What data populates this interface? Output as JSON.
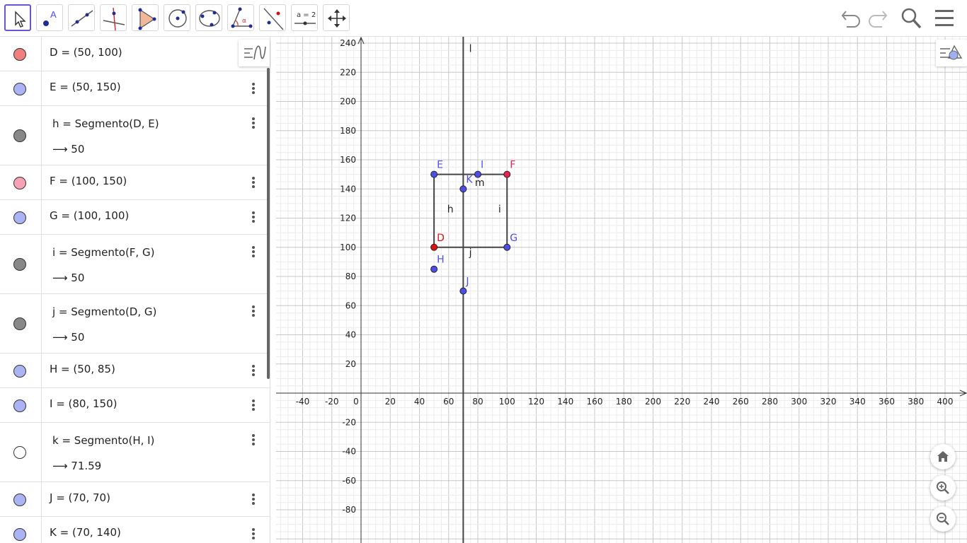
{
  "algebra": {
    "rows": [
      {
        "marble": "#f08080",
        "filled": true,
        "def": "D = (50, 100)",
        "value": ""
      },
      {
        "marble": "#aab4f5",
        "filled": true,
        "def": "E = (50, 150)",
        "value": ""
      },
      {
        "marble": "#888888",
        "filled": true,
        "def": "h = Segmento(D, E)",
        "value": "⟶ 50"
      },
      {
        "marble": "#f8a0b4",
        "filled": true,
        "def": "F = (100, 150)",
        "value": ""
      },
      {
        "marble": "#aab4f5",
        "filled": true,
        "def": "G = (100, 100)",
        "value": ""
      },
      {
        "marble": "#888888",
        "filled": true,
        "def": "i = Segmento(F, G)",
        "value": "⟶ 50"
      },
      {
        "marble": "#888888",
        "filled": true,
        "def": "j = Segmento(D, G)",
        "value": "⟶ 50"
      },
      {
        "marble": "#aab4f5",
        "filled": true,
        "def": "H = (50, 85)",
        "value": ""
      },
      {
        "marble": "#aab4f5",
        "filled": true,
        "def": "I = (80, 150)",
        "value": ""
      },
      {
        "marble": "#ffffff",
        "filled": false,
        "def": "k = Segmento(H, I)",
        "value": "⟶ 71.59"
      },
      {
        "marble": "#aab4f5",
        "filled": true,
        "def": "J = (70, 70)",
        "value": ""
      },
      {
        "marble": "#aab4f5",
        "filled": true,
        "def": "K = (70, 140)",
        "value": ""
      }
    ]
  },
  "toolbar": {
    "tools": [
      "move-tool",
      "point-tool",
      "line-tool",
      "perpendicular-line-tool",
      "polygon-tool",
      "circle-center-point-tool",
      "circle-three-points-tool",
      "angle-tool",
      "reflect-tool",
      "slider-tool",
      "move-graphics-view-tool"
    ],
    "slider_label": "a = 2"
  },
  "graphics": {
    "x_ticks": [
      "-40",
      "-20",
      "0",
      "20",
      "40",
      "60",
      "80",
      "100",
      "120",
      "140",
      "160",
      "180",
      "200",
      "220",
      "240",
      "260",
      "280",
      "300",
      "320",
      "340",
      "360",
      "380",
      "400"
    ],
    "y_ticks": [
      "240",
      "220",
      "200",
      "180",
      "160",
      "140",
      "120",
      "100",
      "80",
      "60",
      "40",
      "20",
      "-20",
      "-40",
      "-60",
      "-80"
    ],
    "points": [
      {
        "name": "D",
        "x": 50,
        "y": 100,
        "color": "#e01010"
      },
      {
        "name": "E",
        "x": 50,
        "y": 150,
        "color": "#4d4ee8"
      },
      {
        "name": "F",
        "x": 100,
        "y": 150,
        "color": "#e8234f"
      },
      {
        "name": "G",
        "x": 100,
        "y": 100,
        "color": "#4d4ee8"
      },
      {
        "name": "H",
        "x": 50,
        "y": 85,
        "color": "#4d4ee8"
      },
      {
        "name": "I",
        "x": 80,
        "y": 150,
        "color": "#4d4ee8"
      },
      {
        "name": "J",
        "x": 70,
        "y": 70,
        "color": "#4d4ee8"
      },
      {
        "name": "K",
        "x": 70,
        "y": 140,
        "color": "#4d4ee8"
      }
    ],
    "segment_labels": [
      "h",
      "i",
      "j",
      "m",
      "l"
    ]
  }
}
